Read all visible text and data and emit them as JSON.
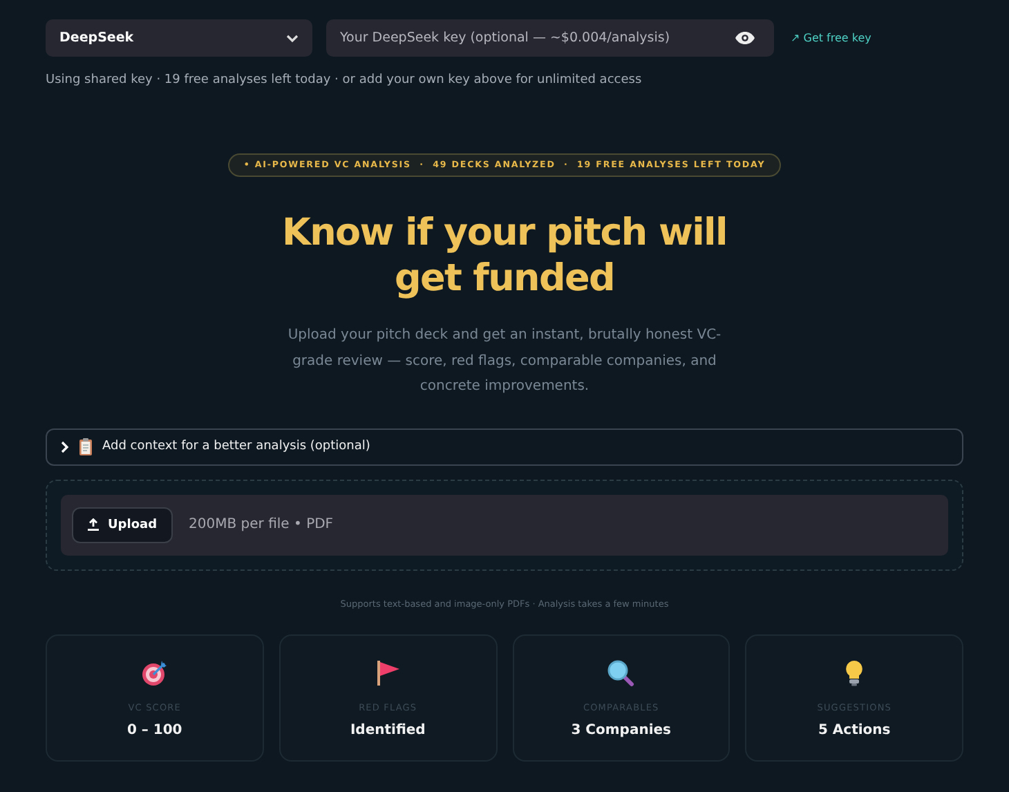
{
  "provider": {
    "value": "DeepSeek"
  },
  "api_key": {
    "placeholder": "Your DeepSeek key (optional — ~$0.004/analysis)"
  },
  "get_key_link": "↗ Get free key",
  "key_note": "Using shared key · 19 free analyses left today · or add your own key above for unlimited access",
  "badge": "• AI-POWERED VC ANALYSIS  ·  49 DECKS ANALYZED  ·  19 FREE ANALYSES LEFT TODAY",
  "title": "Know if your pitch will get funded",
  "subtitle": "Upload your pitch deck and get an instant, brutally honest VC-grade review — score, red flags, comparable companies, and concrete improvements.",
  "context_expander": {
    "label": "Add context for a better analysis (optional)",
    "expanded": false
  },
  "uploader": {
    "button": "Upload",
    "hint": "200MB per file • PDF"
  },
  "upload_note": "Supports text-based and image-only PDFs · Analysis takes a few minutes",
  "features": [
    {
      "kind": "target",
      "label": "VC SCORE",
      "value": "0 – 100"
    },
    {
      "kind": "flag",
      "label": "RED FLAGS",
      "value": "Identified"
    },
    {
      "kind": "magnifier",
      "label": "COMPARABLES",
      "value": "3 Companies"
    },
    {
      "kind": "bulb",
      "label": "SUGGESTIONS",
      "value": "5 Actions"
    }
  ]
}
